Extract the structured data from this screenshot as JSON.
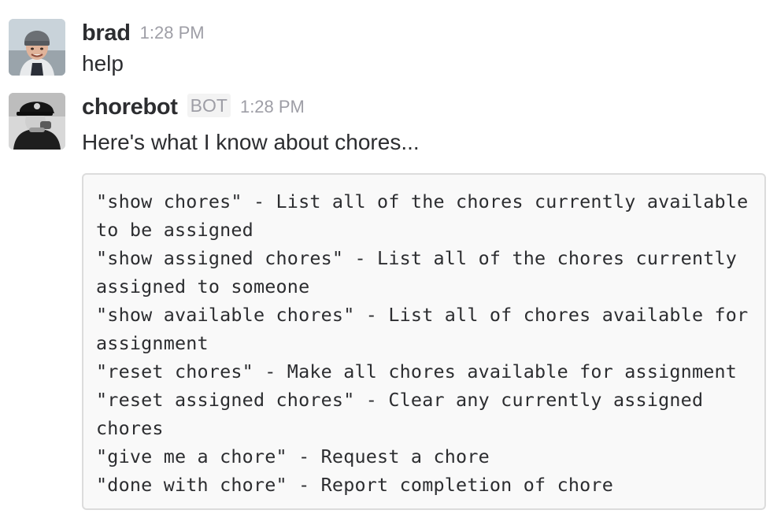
{
  "messages": [
    {
      "username": "brad",
      "timestamp": "1:28 PM",
      "is_bot": false,
      "text": "help",
      "avatar_icon": "user-photo-beanie"
    },
    {
      "username": "chorebot",
      "badge": "BOT",
      "timestamp": "1:28 PM",
      "is_bot": true,
      "text": "Here's what I know about chores...",
      "avatar_icon": "bot-photo-cap",
      "code_lines": [
        "\"show chores\" - List all of the chores currently available",
        "to be assigned",
        "\"show assigned chores\" - List all of the chores currently",
        "assigned to someone",
        "\"show available chores\" - List all of chores available for",
        "assignment",
        "\"reset chores\" - Make all chores available for assignment",
        "\"reset assigned chores\" - Clear any currently assigned",
        "chores",
        "\"give me a chore\" - Request a chore",
        "\"done with chore\" - Report completion of chore"
      ]
    }
  ],
  "colors": {
    "text": "#2c2d30",
    "muted": "#9e9ea6",
    "code_bg": "#f9f9f9",
    "code_border": "#dcdcdc"
  }
}
